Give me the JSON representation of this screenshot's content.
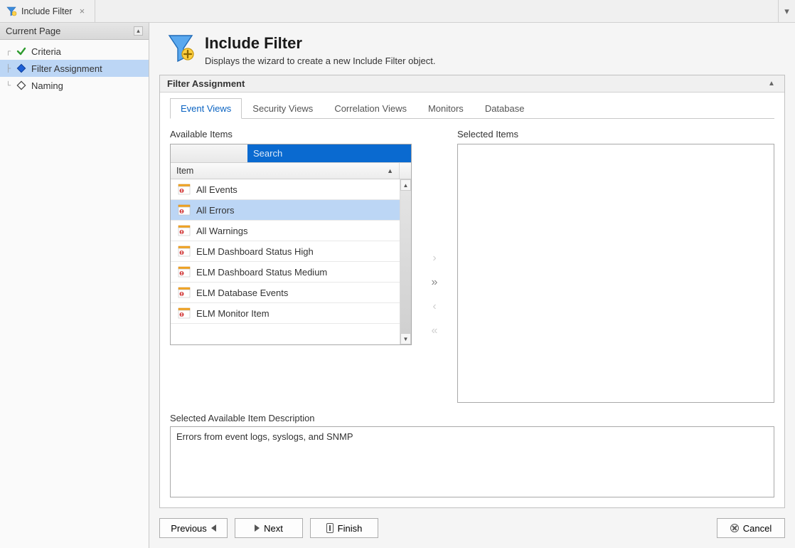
{
  "tab": {
    "title": "Include Filter"
  },
  "sidebar": {
    "title": "Current Page",
    "items": [
      {
        "label": "Criteria",
        "icon": "check",
        "selected": false
      },
      {
        "label": "Filter Assignment",
        "icon": "diamond-blue",
        "selected": true
      },
      {
        "label": "Naming",
        "icon": "diamond-outline",
        "selected": false
      }
    ]
  },
  "header": {
    "title": "Include Filter",
    "subtitle": "Displays the wizard to create a new Include Filter object."
  },
  "panel": {
    "title": "Filter Assignment",
    "tabs": [
      "Event Views",
      "Security Views",
      "Correlation Views",
      "Monitors",
      "Database"
    ],
    "active_tab": 0,
    "available_label": "Available Items",
    "selected_label": "Selected Items",
    "search_placeholder": "Search",
    "column_header": "Item",
    "items": [
      {
        "label": "All  Events",
        "selected": false
      },
      {
        "label": "All Errors",
        "selected": true
      },
      {
        "label": "All Warnings",
        "selected": false
      },
      {
        "label": "ELM Dashboard Status High",
        "selected": false
      },
      {
        "label": "ELM Dashboard Status Medium",
        "selected": false
      },
      {
        "label": "ELM Database Events",
        "selected": false
      },
      {
        "label": "ELM Monitor Item",
        "selected": false
      }
    ],
    "selected_items": [],
    "desc_label": "Selected Available Item Description",
    "description": "Errors from event logs, syslogs, and SNMP"
  },
  "footer": {
    "previous": "Previous",
    "next": "Next",
    "finish": "Finish",
    "cancel": "Cancel"
  }
}
